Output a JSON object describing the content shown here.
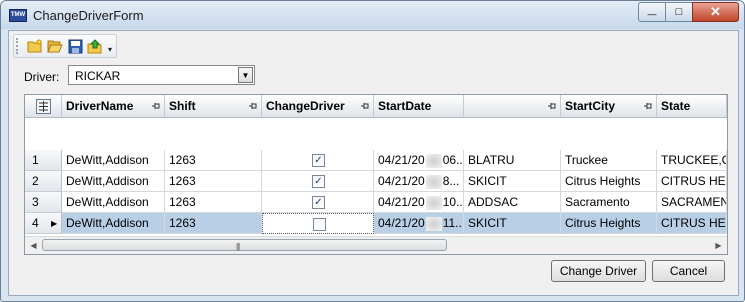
{
  "window": {
    "title": "ChangeDriverForm",
    "app_icon_text": "TMW",
    "minimize_glyph": "—",
    "maximize_glyph": "□",
    "close_glyph": "✕"
  },
  "toolbar": {
    "buttons": [
      "new-folder-icon",
      "open-folder-icon",
      "save-icon",
      "export-icon"
    ],
    "overflow_glyph": "▾"
  },
  "driver": {
    "label": "Driver:",
    "value": "RICKAR",
    "dropdown_glyph": "▼"
  },
  "grid": {
    "columns": [
      "DriverName",
      "Shift",
      "ChangeDriver",
      "StartDate",
      "",
      "StartCity",
      "State"
    ],
    "rows": [
      {
        "num": "1",
        "driver": "DeWitt,Addison",
        "shift": "1263",
        "change": true,
        "date": "04/21/20",
        "time": "06...",
        "code": "BLATRU",
        "city": "Truckee",
        "state": "TRUCKEE,CA,"
      },
      {
        "num": "2",
        "driver": "DeWitt,Addison",
        "shift": "1263",
        "change": true,
        "date": "04/21/20",
        "time": "8...",
        "code": "SKICIT",
        "city": "Citrus Heights",
        "state": "CITRUS HEIG"
      },
      {
        "num": "3",
        "driver": "DeWitt,Addison",
        "shift": "1263",
        "change": true,
        "date": "04/21/20",
        "time": "10...",
        "code": "ADDSAC",
        "city": "Sacramento",
        "state": "SACRAMENTO"
      },
      {
        "num": "4",
        "driver": "DeWitt,Addison",
        "shift": "1263",
        "change": false,
        "date": "04/21/20",
        "time": "11...",
        "code": "SKICIT",
        "city": "Citrus Heights",
        "state": "CITRUS HEIG"
      }
    ],
    "selected_row": 4,
    "current_row_glyph": "▶",
    "check_glyph": "✓",
    "scroll_left_glyph": "◀",
    "scroll_right_glyph": "▶",
    "thumb_grip": "|||"
  },
  "buttons": {
    "change_driver": "Change Driver",
    "cancel": "Cancel"
  },
  "colors": {
    "selection": "#b9cfe6",
    "title_gradient_top": "#e4edf7",
    "close_button": "#c2452c"
  }
}
